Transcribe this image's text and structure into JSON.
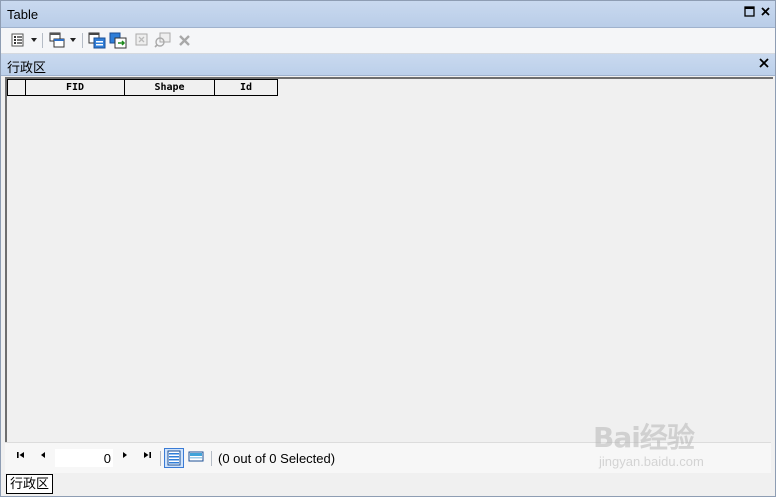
{
  "window": {
    "title": "Table"
  },
  "titlebar": {
    "maximize_icon": "square-icon",
    "close_icon": "close-icon"
  },
  "toolbar": {
    "items": [
      "table-options-icon",
      "related-tables-icon",
      "select-by-attributes-icon",
      "switch-selection-icon",
      "clear-selection-icon",
      "zoom-to-selected-icon",
      "delete-selected-icon"
    ]
  },
  "layer": {
    "name": "行政区"
  },
  "grid": {
    "columns": [
      "FID",
      "Shape",
      "Id"
    ],
    "rows": []
  },
  "navbar": {
    "current_record": "0",
    "selection_text": "(0 out of 0 Selected)",
    "view_modes": [
      "show-all-records",
      "show-selected-records"
    ]
  },
  "tabs": [
    {
      "label": "行政区"
    }
  ],
  "watermark": {
    "logo": "Bai经验",
    "url": "jingyan.baidu.com"
  },
  "colors": {
    "titlebar": "#c9d9ef",
    "active_view": "#cfe3fb",
    "accent": "#3a7bd5"
  }
}
